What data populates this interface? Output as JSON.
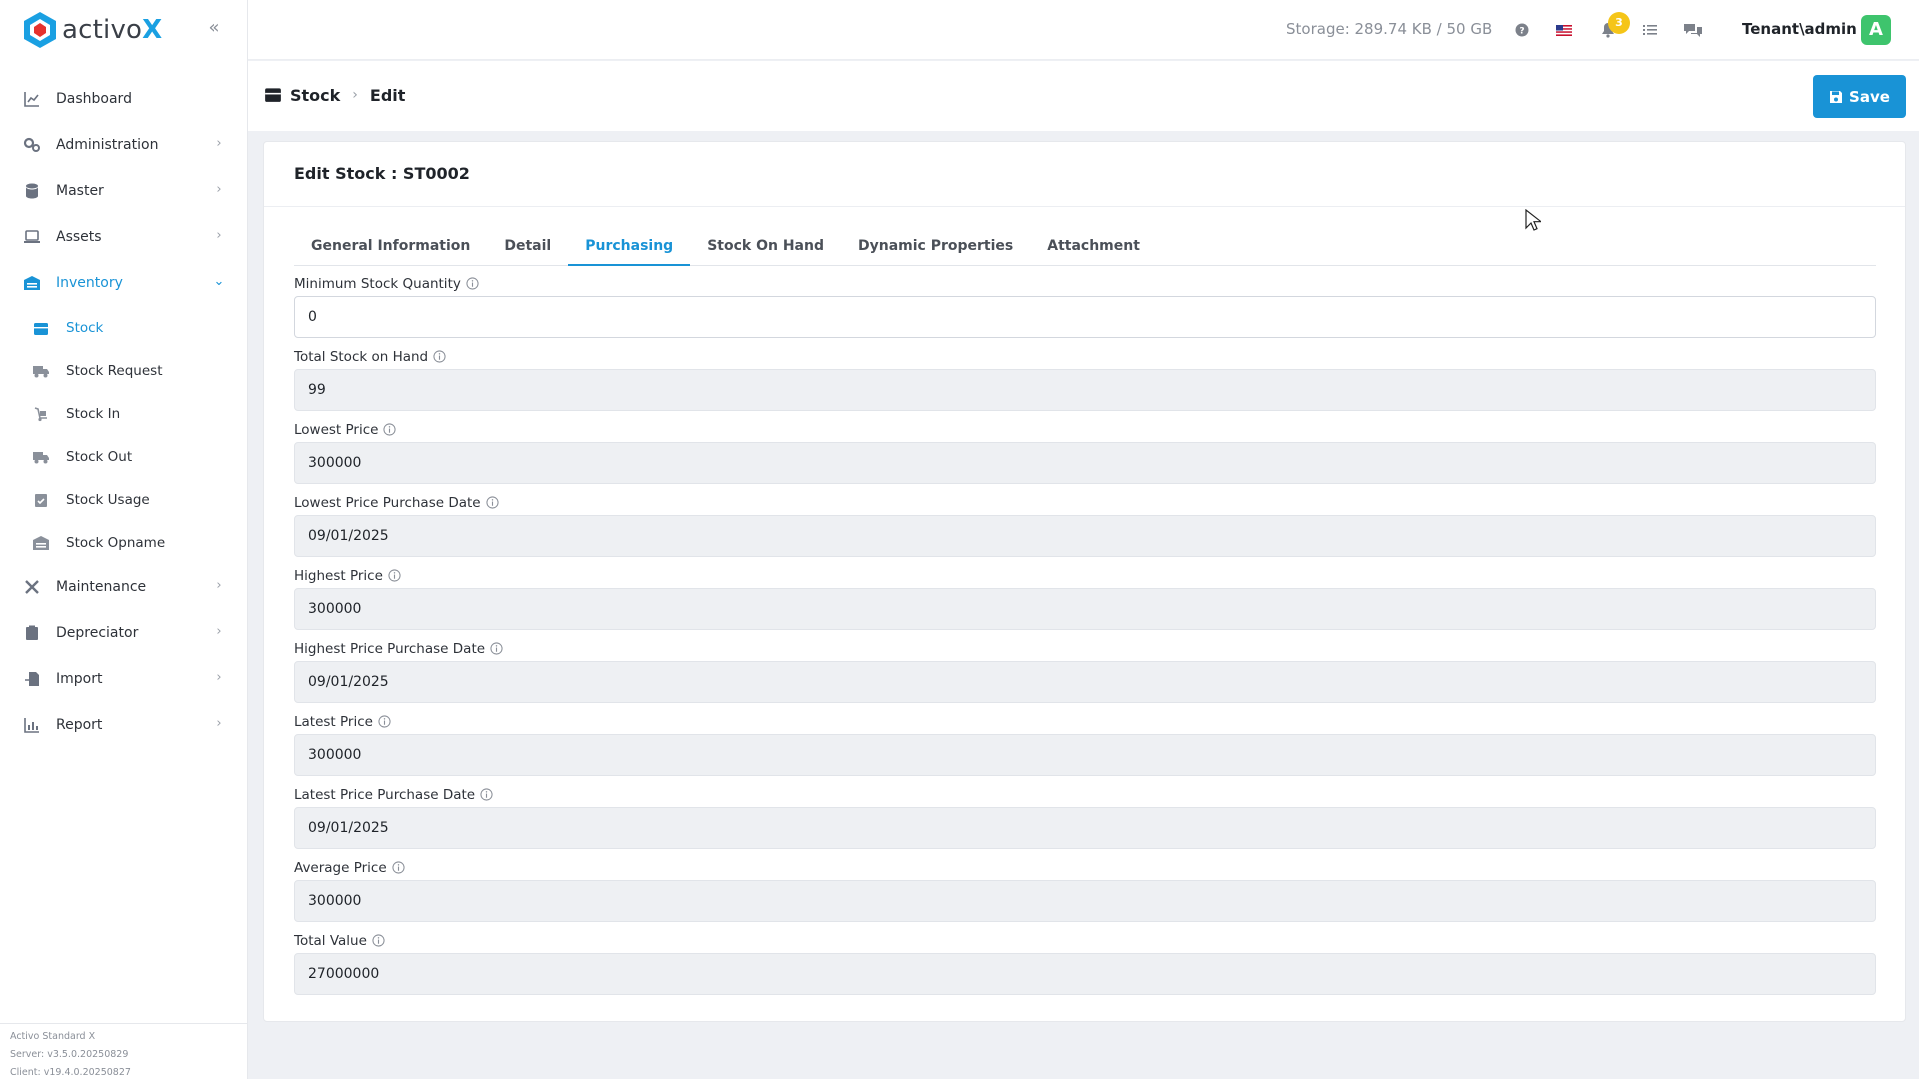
{
  "app": {
    "logo_prefix": "activo",
    "logo_suffix": "X"
  },
  "sidebar": {
    "items": [
      {
        "label": "Dashboard",
        "icon": "chart-line-icon"
      },
      {
        "label": "Administration",
        "icon": "gears-icon"
      },
      {
        "label": "Master",
        "icon": "database-icon"
      },
      {
        "label": "Assets",
        "icon": "laptop-icon"
      },
      {
        "label": "Inventory",
        "icon": "warehouse-icon",
        "active": true
      },
      {
        "label": "Maintenance",
        "icon": "tools-icon"
      },
      {
        "label": "Depreciator",
        "icon": "clipboard-icon"
      },
      {
        "label": "Import",
        "icon": "file-import-icon"
      },
      {
        "label": "Report",
        "icon": "bar-chart-icon"
      }
    ],
    "inventory_sub": [
      {
        "label": "Stock",
        "icon": "box-icon",
        "active": true
      },
      {
        "label": "Stock Request",
        "icon": "truck-icon"
      },
      {
        "label": "Stock In",
        "icon": "dolly-icon"
      },
      {
        "label": "Stock Out",
        "icon": "truck-out-icon"
      },
      {
        "label": "Stock Usage",
        "icon": "clipboard-check-icon"
      },
      {
        "label": "Stock Opname",
        "icon": "warehouse-icon"
      }
    ],
    "footer": {
      "product": "Activo Standard X",
      "server": "Server: v3.5.0.20250829",
      "client": "Client: v19.4.0.20250827"
    }
  },
  "topbar": {
    "storage": "Storage: 289.74 KB / 50 GB",
    "notification_count": "3",
    "user": "Tenant\\admin",
    "avatar_letter": "A"
  },
  "page": {
    "breadcrumb_root": "Stock",
    "breadcrumb_current": "Edit",
    "save_label": "Save",
    "card_title": "Edit Stock : ST0002",
    "tabs": [
      "General Information",
      "Detail",
      "Purchasing",
      "Stock On Hand",
      "Dynamic Properties",
      "Attachment"
    ],
    "active_tab": "Purchasing",
    "fields": [
      {
        "label": "Minimum Stock Quantity",
        "value": "0",
        "editable": true
      },
      {
        "label": "Total Stock on Hand",
        "value": "99",
        "editable": false
      },
      {
        "label": "Lowest Price",
        "value": "300000",
        "editable": false
      },
      {
        "label": "Lowest Price Purchase Date",
        "value": "09/01/2025",
        "editable": false
      },
      {
        "label": "Highest Price",
        "value": "300000",
        "editable": false
      },
      {
        "label": "Highest Price Purchase Date",
        "value": "09/01/2025",
        "editable": false
      },
      {
        "label": "Latest Price",
        "value": "300000",
        "editable": false
      },
      {
        "label": "Latest Price Purchase Date",
        "value": "09/01/2025",
        "editable": false
      },
      {
        "label": "Average Price",
        "value": "300000",
        "editable": false
      },
      {
        "label": "Total Value",
        "value": "27000000",
        "editable": false
      }
    ]
  },
  "colors": {
    "accent": "#1993d6",
    "badge": "#f5c518",
    "avatar": "#3ec46d"
  }
}
